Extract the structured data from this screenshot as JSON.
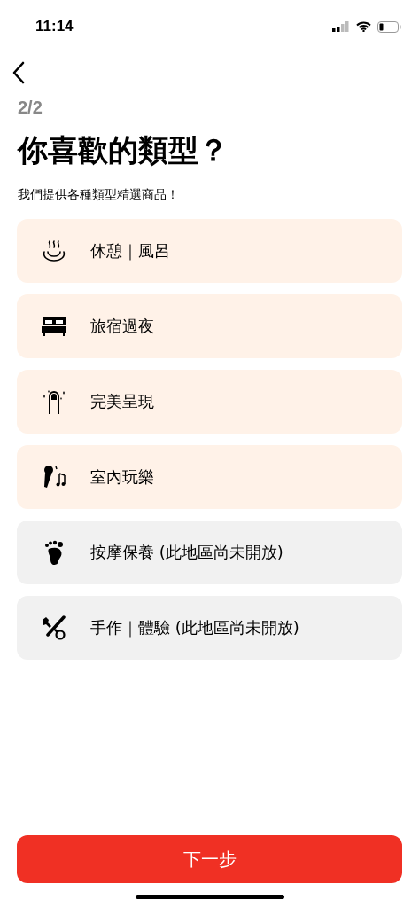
{
  "status_bar": {
    "time": "11:14"
  },
  "step": "2/2",
  "title": "你喜歡的類型？",
  "subtitle": "我們提供各種類型精選商品！",
  "options": [
    {
      "kind": "hotspring",
      "label": "休憩｜風呂",
      "disabled": false
    },
    {
      "kind": "bed",
      "label": "旅宿過夜",
      "disabled": false
    },
    {
      "kind": "nail",
      "label": "完美呈現",
      "disabled": false
    },
    {
      "kind": "karaoke",
      "label": "室內玩樂",
      "disabled": false
    },
    {
      "kind": "foot",
      "label": "按摩保養 (此地區尚未開放)",
      "disabled": true
    },
    {
      "kind": "tools",
      "label": "手作｜體驗 (此地區尚未開放)",
      "disabled": true
    }
  ],
  "next_button": "下一步"
}
